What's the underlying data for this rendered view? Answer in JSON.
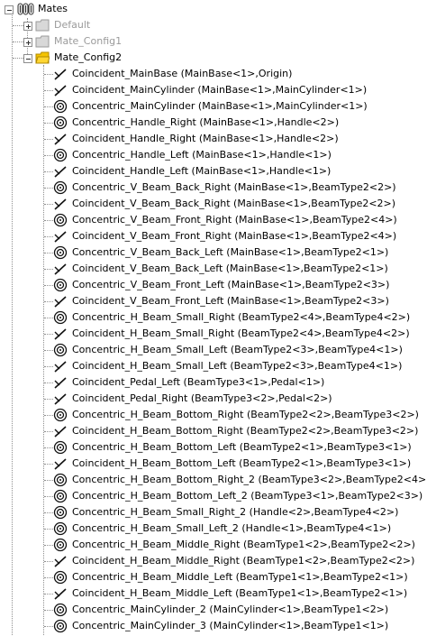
{
  "root": {
    "label": "Mates",
    "icon": "mates-folder-icon"
  },
  "configs": [
    {
      "label": "Default",
      "state": "inactive",
      "icon": "folder-icon"
    },
    {
      "label": "Mate_Config1",
      "state": "inactive",
      "icon": "folder-icon"
    },
    {
      "label": "Mate_Config2",
      "state": "active",
      "icon": "folder-open-icon"
    }
  ],
  "mates": [
    {
      "type": "coincident",
      "label": "Coincident_MainBase (MainBase<1>,Origin)"
    },
    {
      "type": "coincident",
      "label": "Coincident_MainCylinder (MainBase<1>,MainCylinder<1>)"
    },
    {
      "type": "concentric",
      "label": "Concentric_MainCylinder (MainBase<1>,MainCylinder<1>)"
    },
    {
      "type": "concentric",
      "label": "Concentric_Handle_Right (MainBase<1>,Handle<2>)"
    },
    {
      "type": "coincident",
      "label": "Coincident_Handle_Right (MainBase<1>,Handle<2>)"
    },
    {
      "type": "concentric",
      "label": "Concentric_Handle_Left (MainBase<1>,Handle<1>)"
    },
    {
      "type": "coincident",
      "label": "Coincident_Handle_Left (MainBase<1>,Handle<1>)"
    },
    {
      "type": "concentric",
      "label": "Concentric_V_Beam_Back_Right (MainBase<1>,BeamType2<2>)"
    },
    {
      "type": "coincident",
      "label": "Coincident_V_Beam_Back_Right (MainBase<1>,BeamType2<2>)"
    },
    {
      "type": "concentric",
      "label": "Concentric_V_Beam_Front_Right (MainBase<1>,BeamType2<4>)"
    },
    {
      "type": "coincident",
      "label": "Coincident_V_Beam_Front_Right (MainBase<1>,BeamType2<4>)"
    },
    {
      "type": "concentric",
      "label": "Concentric_V_Beam_Back_Left (MainBase<1>,BeamType2<1>)"
    },
    {
      "type": "coincident",
      "label": "Coincident_V_Beam_Back_Left (MainBase<1>,BeamType2<1>)"
    },
    {
      "type": "concentric",
      "label": "Concentric_V_Beam_Front_Left (MainBase<1>,BeamType2<3>)"
    },
    {
      "type": "coincident",
      "label": "Coincident_V_Beam_Front_Left (MainBase<1>,BeamType2<3>)"
    },
    {
      "type": "concentric",
      "label": "Concentric_H_Beam_Small_Right (BeamType2<4>,BeamType4<2>)"
    },
    {
      "type": "coincident",
      "label": "Coincident_H_Beam_Small_Right (BeamType2<4>,BeamType4<2>)"
    },
    {
      "type": "concentric",
      "label": "Concentric_H_Beam_Small_Left (BeamType2<3>,BeamType4<1>)"
    },
    {
      "type": "coincident",
      "label": "Coincident_H_Beam_Small_Left (BeamType2<3>,BeamType4<1>)"
    },
    {
      "type": "coincident",
      "label": "Coincident_Pedal_Left (BeamType3<1>,Pedal<1>)"
    },
    {
      "type": "coincident",
      "label": "Coincident_Pedal_Right (BeamType3<2>,Pedal<2>)"
    },
    {
      "type": "concentric",
      "label": "Concentric_H_Beam_Bottom_Right (BeamType2<2>,BeamType3<2>)"
    },
    {
      "type": "coincident",
      "label": "Coincident_H_Beam_Bottom_Right (BeamType2<2>,BeamType3<2>)"
    },
    {
      "type": "concentric",
      "label": "Concentric_H_Beam_Bottom_Left (BeamType2<1>,BeamType3<1>)"
    },
    {
      "type": "coincident",
      "label": "Coincident_H_Beam_Bottom_Left (BeamType2<1>,BeamType3<1>)"
    },
    {
      "type": "concentric",
      "label": "Concentric_H_Beam_Bottom_Right_2 (BeamType3<2>,BeamType2<4>)"
    },
    {
      "type": "concentric",
      "label": "Concentric_H_Beam_Bottom_Left_2 (BeamType3<1>,BeamType2<3>)"
    },
    {
      "type": "concentric",
      "label": "Concentric_H_Beam_Small_Right_2 (Handle<2>,BeamType4<2>)"
    },
    {
      "type": "concentric",
      "label": "Concentric_H_Beam_Small_Left_2 (Handle<1>,BeamType4<1>)"
    },
    {
      "type": "concentric",
      "label": "Concentric_H_Beam_Middle_Right (BeamType1<2>,BeamType2<2>)"
    },
    {
      "type": "coincident",
      "label": "Coincident_H_Beam_Middle_Right (BeamType1<2>,BeamType2<2>)"
    },
    {
      "type": "concentric",
      "label": "Concentric_H_Beam_Middle_Left (BeamType1<1>,BeamType2<1>)"
    },
    {
      "type": "coincident",
      "label": "Coincident_H_Beam_Middle_Left (BeamType1<1>,BeamType2<1>)"
    },
    {
      "type": "concentric",
      "label": "Concentric_MainCylinder_2 (MainCylinder<1>,BeamType1<2>)"
    },
    {
      "type": "concentric",
      "label": "Concentric_MainCylinder_3 (MainCylinder<1>,BeamType1<1>)"
    }
  ],
  "colors": {
    "inactive_text": "#9a9a9a",
    "tree_lines": "#8f8f8f",
    "folder_active": "#f5c400",
    "folder_inactive": "#d8d8d8"
  }
}
